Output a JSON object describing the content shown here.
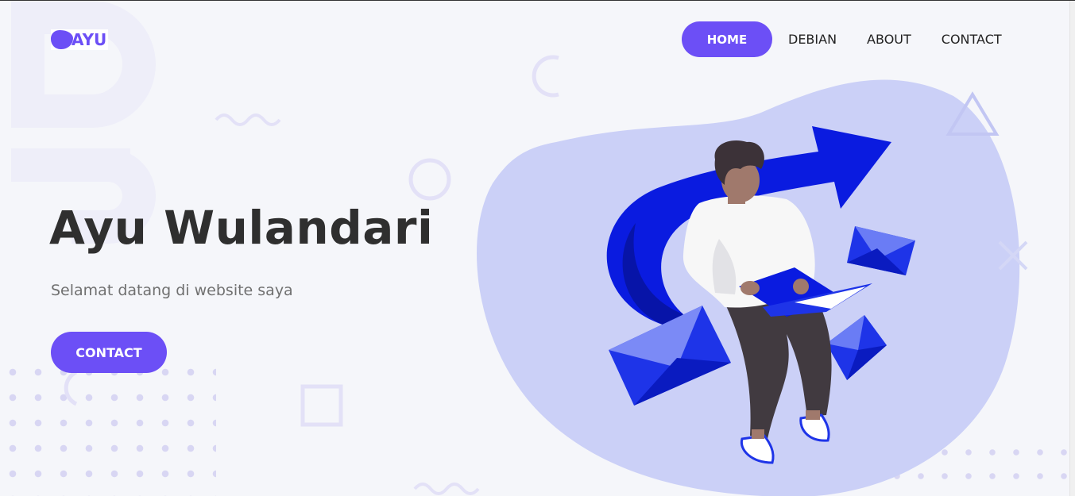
{
  "header": {
    "logo_text": "AYU",
    "nav": [
      {
        "label": "HOME",
        "active": true
      },
      {
        "label": "DEBIAN",
        "active": false
      },
      {
        "label": "ABOUT",
        "active": false
      },
      {
        "label": "CONTACT",
        "active": false
      }
    ]
  },
  "hero": {
    "title": "Ayu Wulandari",
    "subtitle": "Selamat datang di website saya",
    "button_label": "CONTACT"
  },
  "colors": {
    "accent": "#6c4ff6",
    "blob": "#cbd0f7",
    "arrow_blue": "#0a1be0",
    "background": "#f5f6fa",
    "title_text": "#2f2f2f"
  },
  "illustration": {
    "icons": [
      "person-icon",
      "laptop-icon",
      "envelope-icon",
      "arrow-icon"
    ]
  }
}
